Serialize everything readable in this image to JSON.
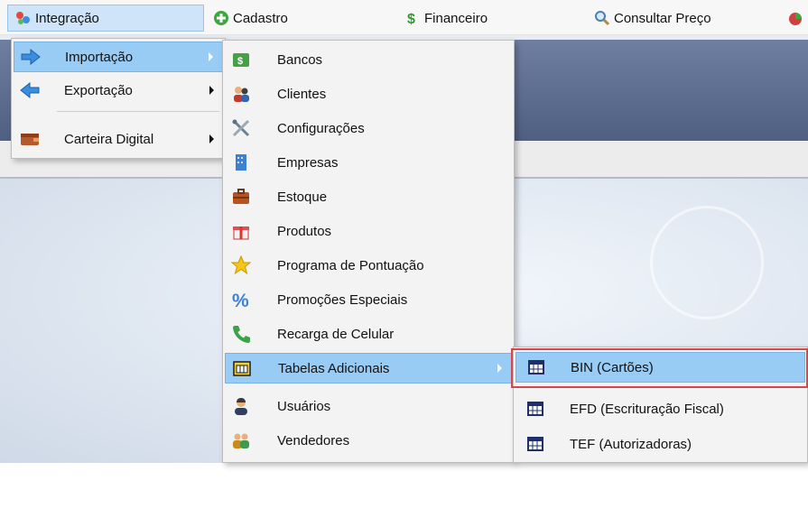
{
  "menubar": {
    "items": [
      {
        "label": "Integração",
        "icon": "integration-icon"
      },
      {
        "label": "Cadastro",
        "icon": "plus-circle-icon"
      },
      {
        "label": "Financeiro",
        "icon": "dollar-icon"
      },
      {
        "label": "Consultar Preço",
        "icon": "magnifier-icon"
      }
    ]
  },
  "integracao_menu": {
    "items": [
      {
        "label": "Importação",
        "icon": "arrow-right-icon"
      },
      {
        "label": "Exportação",
        "icon": "arrow-left-icon"
      },
      {
        "label": "Carteira Digital",
        "icon": "wallet-icon"
      }
    ]
  },
  "importacao_menu": {
    "items": [
      {
        "label": "Bancos",
        "icon": "bank-icon"
      },
      {
        "label": "Clientes",
        "icon": "clients-icon"
      },
      {
        "label": "Configurações",
        "icon": "tools-icon"
      },
      {
        "label": "Empresas",
        "icon": "building-icon"
      },
      {
        "label": "Estoque",
        "icon": "briefcase-icon"
      },
      {
        "label": "Produtos",
        "icon": "gift-icon"
      },
      {
        "label": "Programa de Pontuação",
        "icon": "star-icon"
      },
      {
        "label": "Promoções Especiais",
        "icon": "percent-icon"
      },
      {
        "label": "Recarga de Celular",
        "icon": "phone-icon"
      },
      {
        "label": "Tabelas Adicionais",
        "icon": "table-folder-icon"
      },
      {
        "label": "Usuários",
        "icon": "user-icon"
      },
      {
        "label": "Vendedores",
        "icon": "sellers-icon"
      }
    ]
  },
  "tabelas_menu": {
    "items": [
      {
        "label": "BIN (Cartões)",
        "icon": "table-icon"
      },
      {
        "label": "EFD (Escrituração Fiscal)",
        "icon": "table-icon"
      },
      {
        "label": "TEF (Autorizadoras)",
        "icon": "table-icon"
      }
    ]
  }
}
